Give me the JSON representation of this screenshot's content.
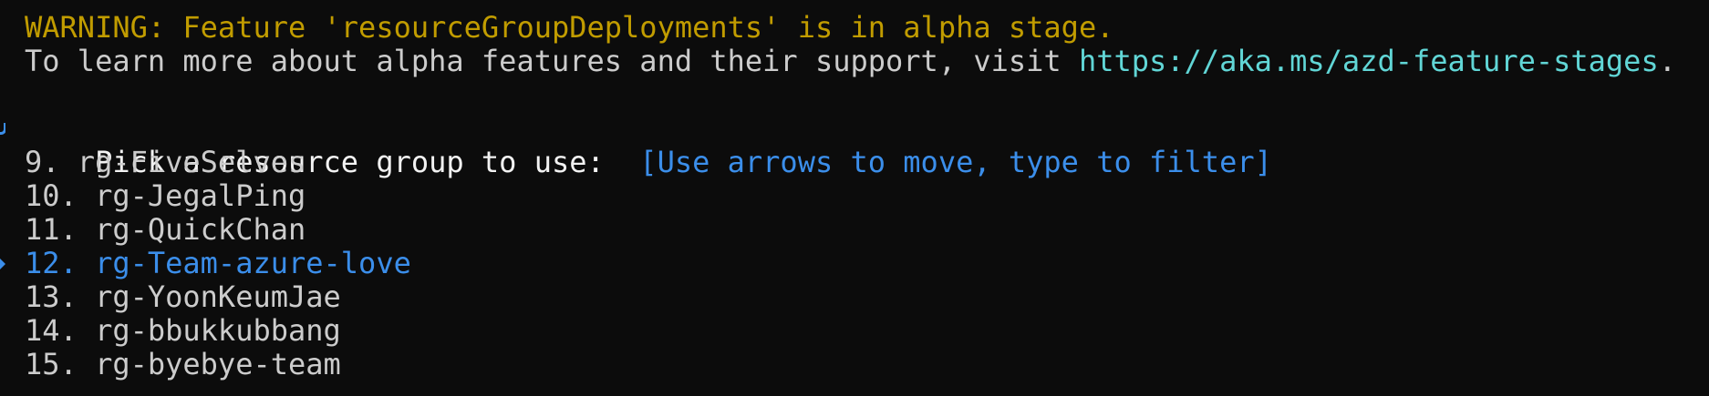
{
  "warning": {
    "line1": "WARNING: Feature 'resourceGroupDeployments' is in alpha stage.",
    "line2_prefix": "To learn more about alpha features and their support, visit ",
    "link": "https://aka.ms/azd-feature-stages",
    "line2_suffix": "."
  },
  "prompt": {
    "question": "Pick a resource group to use:  ",
    "hint": "[Use arrows to move, type to filter]"
  },
  "options": [
    {
      "label": "9. rg-FiveSelves",
      "selected": false
    },
    {
      "label": "10. rg-JegalPing",
      "selected": false
    },
    {
      "label": "11. rg-QuickChan",
      "selected": false
    },
    {
      "label": "12. rg-Team-azure-love",
      "selected": true
    },
    {
      "label": "13. rg-YoonKeumJae",
      "selected": false
    },
    {
      "label": "14. rg-bbukkubbang",
      "selected": false
    },
    {
      "label": "15. rg-byebye-team",
      "selected": false
    }
  ],
  "colors": {
    "background": "#0c0c0c",
    "warning": "#c19c00",
    "link": "#61d6d6",
    "selected": "#3b8eea",
    "text": "#cccccc"
  }
}
